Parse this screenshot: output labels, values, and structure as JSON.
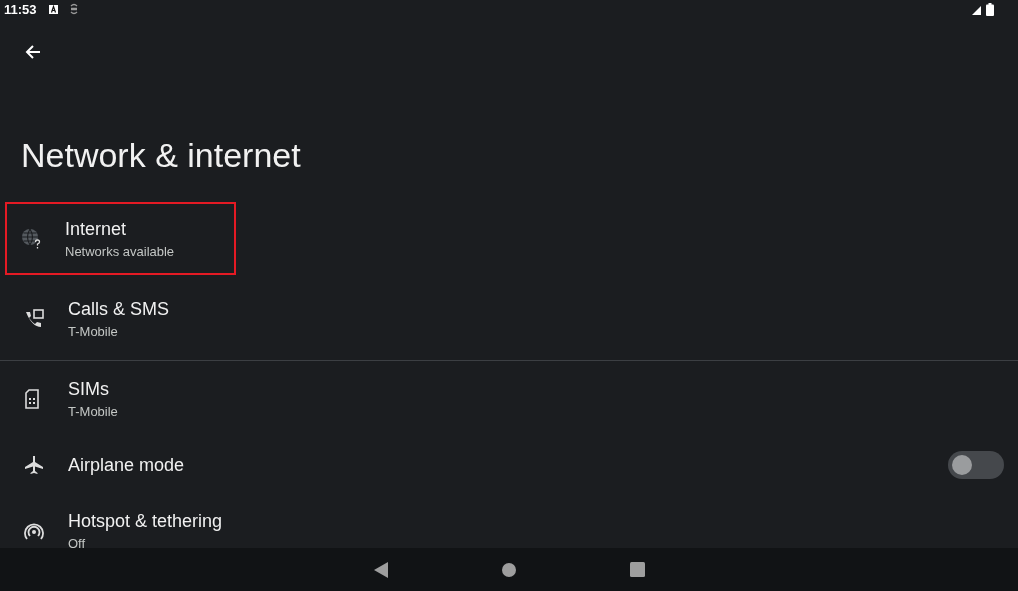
{
  "status_bar": {
    "time": "11:53"
  },
  "title": "Network & internet",
  "groups": [
    [
      {
        "kind": "link",
        "title": "Internet",
        "subtitle": "Networks available",
        "highlighted": true
      },
      {
        "kind": "link",
        "title": "Calls & SMS",
        "subtitle": "T-Mobile",
        "highlighted": false
      }
    ],
    [
      {
        "kind": "link",
        "title": "SIMs",
        "subtitle": "T-Mobile",
        "highlighted": false
      },
      {
        "kind": "switch",
        "title": "Airplane mode",
        "on": false,
        "highlighted": false
      },
      {
        "kind": "link",
        "title": "Hotspot & tethering",
        "subtitle": "Off",
        "highlighted": false
      }
    ]
  ]
}
